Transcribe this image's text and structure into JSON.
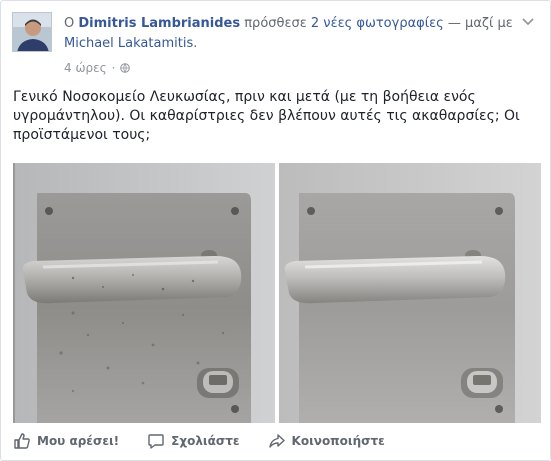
{
  "header": {
    "prefix": "Ο",
    "author": "Dimitris Lambrianides",
    "verb": "πρόσθεσε",
    "photos_count": "2 νέες φωτογραφίες",
    "with_text": "— μαζί με",
    "tagged": "Michael Lakatamitis",
    "period": "."
  },
  "meta": {
    "time": "4 ώρες",
    "separator": "·",
    "privacy_icon": "globe-icon"
  },
  "post": {
    "text": "Γενικό Νοσοκομείο Λευκωσίας, πριν και μετά (με τη βοήθεια ενός υγρομάντηλου). Οι καθαρίστριες δεν βλέπουν αυτές τις ακαθαρσίες; Οι προϊστάμενοι τους;"
  },
  "actions": {
    "like": "Μου αρέσει!",
    "comment": "Σχολιάστε",
    "share": "Κοινοποιήστε"
  },
  "colors": {
    "link": "#365899",
    "muted": "#90949c",
    "text": "#1d2129",
    "action": "#616770"
  }
}
